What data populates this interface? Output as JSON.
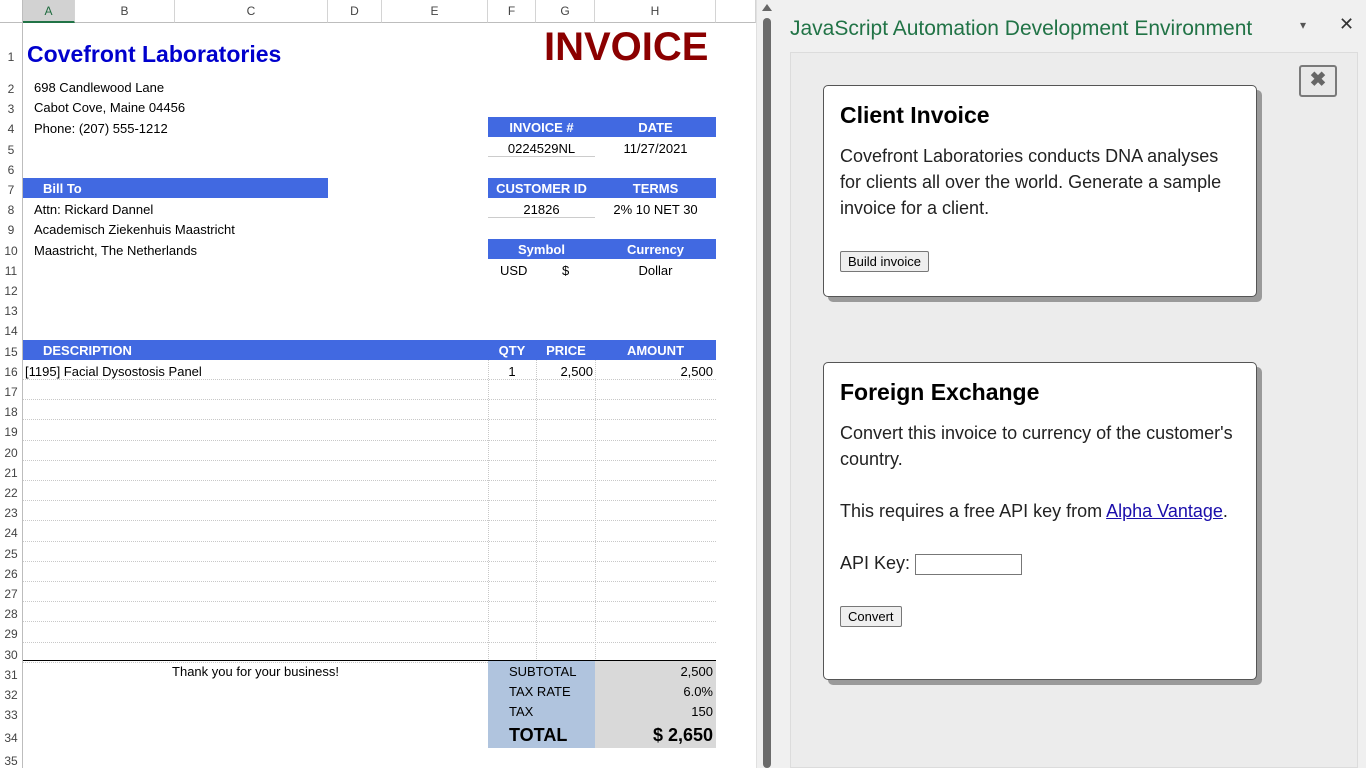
{
  "spreadsheet": {
    "columns": [
      "A",
      "B",
      "C",
      "D",
      "E",
      "F",
      "G",
      "H"
    ],
    "rows": [
      "1",
      "2",
      "3",
      "4",
      "5",
      "6",
      "7",
      "8",
      "9",
      "10",
      "11",
      "12",
      "13",
      "14",
      "15",
      "16",
      "17",
      "18",
      "19",
      "20",
      "21",
      "22",
      "23",
      "24",
      "25",
      "26",
      "27",
      "28",
      "29",
      "30",
      "31",
      "32",
      "33",
      "34",
      "35"
    ],
    "company_name": "Covefront Laboratories",
    "invoice_title": "INVOICE",
    "address_line1": "698 Candlewood Lane",
    "address_line2": "Cabot Cove, Maine 04456",
    "phone": "Phone: (207) 555-1212",
    "invoice_no_label": "INVOICE #",
    "date_label": "DATE",
    "invoice_no": "0224529NL",
    "date": "11/27/2021",
    "bill_to_label": "Bill To",
    "customer_id_label": "CUSTOMER ID",
    "terms_label": "TERMS",
    "customer_id": "21826",
    "terms": "2% 10 NET 30",
    "attn": "Attn: Rickard Dannel",
    "org": "Academisch Ziekenhuis Maastricht",
    "city": "Maastricht, The Netherlands",
    "symbol_label": "Symbol",
    "currency_label": "Currency",
    "currency_code": "USD",
    "currency_symbol": "$",
    "currency_name": "Dollar",
    "desc_label": "DESCRIPTION",
    "qty_label": "QTY",
    "price_label": "PRICE",
    "amount_label": "AMOUNT",
    "line_items": [
      {
        "description": "[1195] Facial Dysostosis Panel",
        "qty": "1",
        "price": "2,500",
        "amount": "2,500"
      }
    ],
    "thank_you": "Thank you for your business!",
    "subtotal_label": "SUBTOTAL",
    "subtotal": "2,500",
    "tax_rate_label": "TAX RATE",
    "tax_rate": "6.0%",
    "tax_label": "TAX",
    "tax": "150",
    "total_label": "TOTAL",
    "total": "$ 2,650"
  },
  "pane": {
    "title": "JavaScript Automation Development Environment",
    "menu_icon": "▾",
    "close_icon": "✕",
    "inner_close_icon": "✖",
    "card1": {
      "heading": "Client Invoice",
      "text": "Covefront Laboratories conducts DNA analyses for clients all over the world. Generate a sample invoice for a client.",
      "button": "Build invoice"
    },
    "card2": {
      "heading": "Foreign Exchange",
      "text": "Convert this invoice to currency of the customer's country.",
      "api_text_prefix": "This requires a free API key from ",
      "api_link": "Alpha Vantage",
      "api_text_suffix": ".",
      "api_key_label": "API Key:",
      "api_key_value": "",
      "button": "Convert"
    }
  }
}
